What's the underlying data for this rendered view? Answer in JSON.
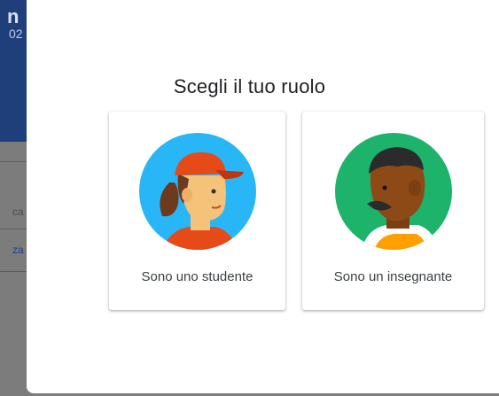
{
  "background": {
    "title_fragment": "n",
    "subtitle_fragment": "02",
    "text_fragment_1": "ca",
    "text_fragment_2": "za"
  },
  "dialog": {
    "title": "Scegli il tuo ruolo",
    "roles": [
      {
        "label": "Sono uno studente",
        "icon": "student-avatar-icon",
        "accent": "#29b6f6"
      },
      {
        "label": "Sono un insegnante",
        "icon": "teacher-avatar-icon",
        "accent": "#1db36b"
      }
    ]
  }
}
